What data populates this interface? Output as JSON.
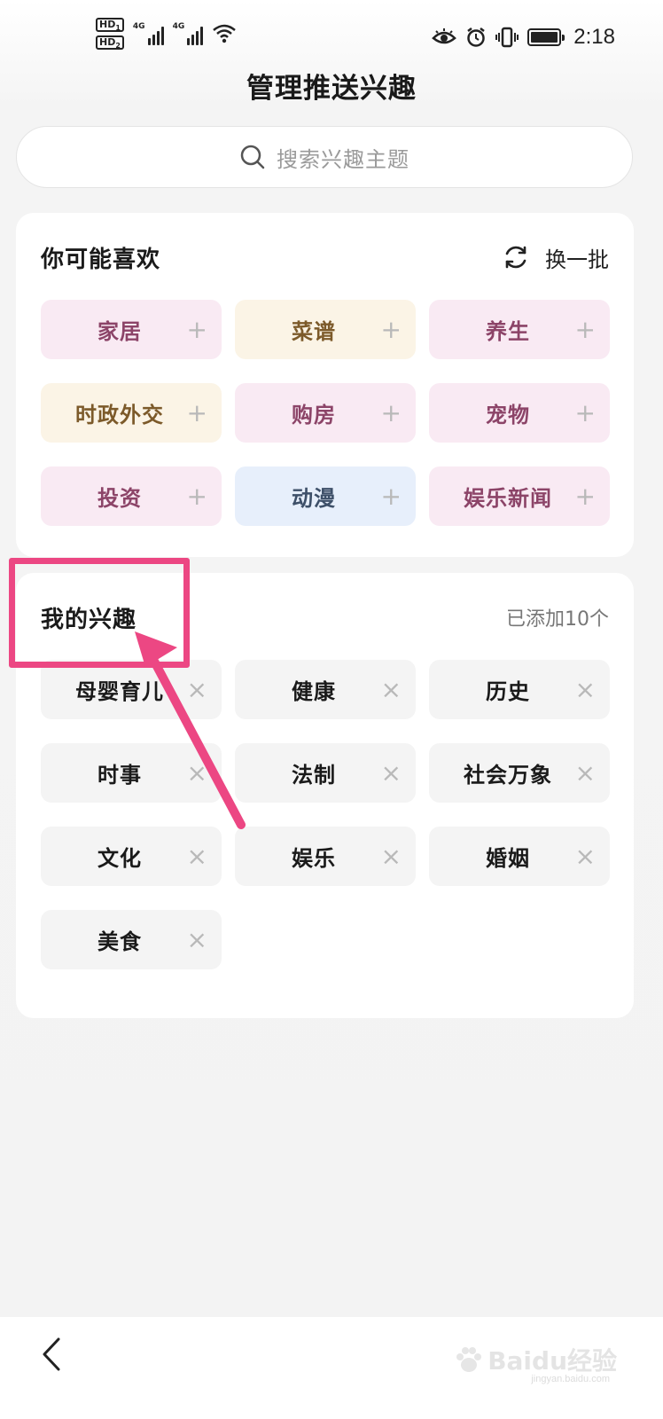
{
  "status": {
    "hd1": "HD",
    "hd1_sub": "1",
    "hd2": "HD",
    "hd2_sub": "2",
    "net1": "4G",
    "net2": "4G",
    "time": "2:18"
  },
  "header": {
    "title": "管理推送兴趣"
  },
  "search": {
    "placeholder": "搜索兴趣主题"
  },
  "suggest": {
    "title": "你可能喜欢",
    "refresh_label": "换一批",
    "items": [
      {
        "label": "家居",
        "tone": "pink"
      },
      {
        "label": "菜谱",
        "tone": "cream"
      },
      {
        "label": "养生",
        "tone": "pink"
      },
      {
        "label": "时政外交",
        "tone": "cream"
      },
      {
        "label": "购房",
        "tone": "pink"
      },
      {
        "label": "宠物",
        "tone": "pink"
      },
      {
        "label": "投资",
        "tone": "pink"
      },
      {
        "label": "动漫",
        "tone": "blue"
      },
      {
        "label": "娱乐新闻",
        "tone": "pink"
      }
    ],
    "add_glyph": "+"
  },
  "mine": {
    "title": "我的兴趣",
    "count": "已添加10个",
    "items": [
      {
        "label": "母婴育儿"
      },
      {
        "label": "健康"
      },
      {
        "label": "历史"
      },
      {
        "label": "时事"
      },
      {
        "label": "法制"
      },
      {
        "label": "社会万象"
      },
      {
        "label": "文化"
      },
      {
        "label": "娱乐"
      },
      {
        "label": "婚姻"
      },
      {
        "label": "美食"
      }
    ],
    "remove_glyph": "×"
  },
  "watermark": {
    "brand": "Baidu经验",
    "site": "jingyan.baidu.com"
  },
  "colors": {
    "annotation": "#ec4783",
    "pink_bg": "#f9eaf3",
    "cream_bg": "#fbf4e6",
    "blue_bg": "#e7effb",
    "grey_bg": "#f4f4f4"
  }
}
